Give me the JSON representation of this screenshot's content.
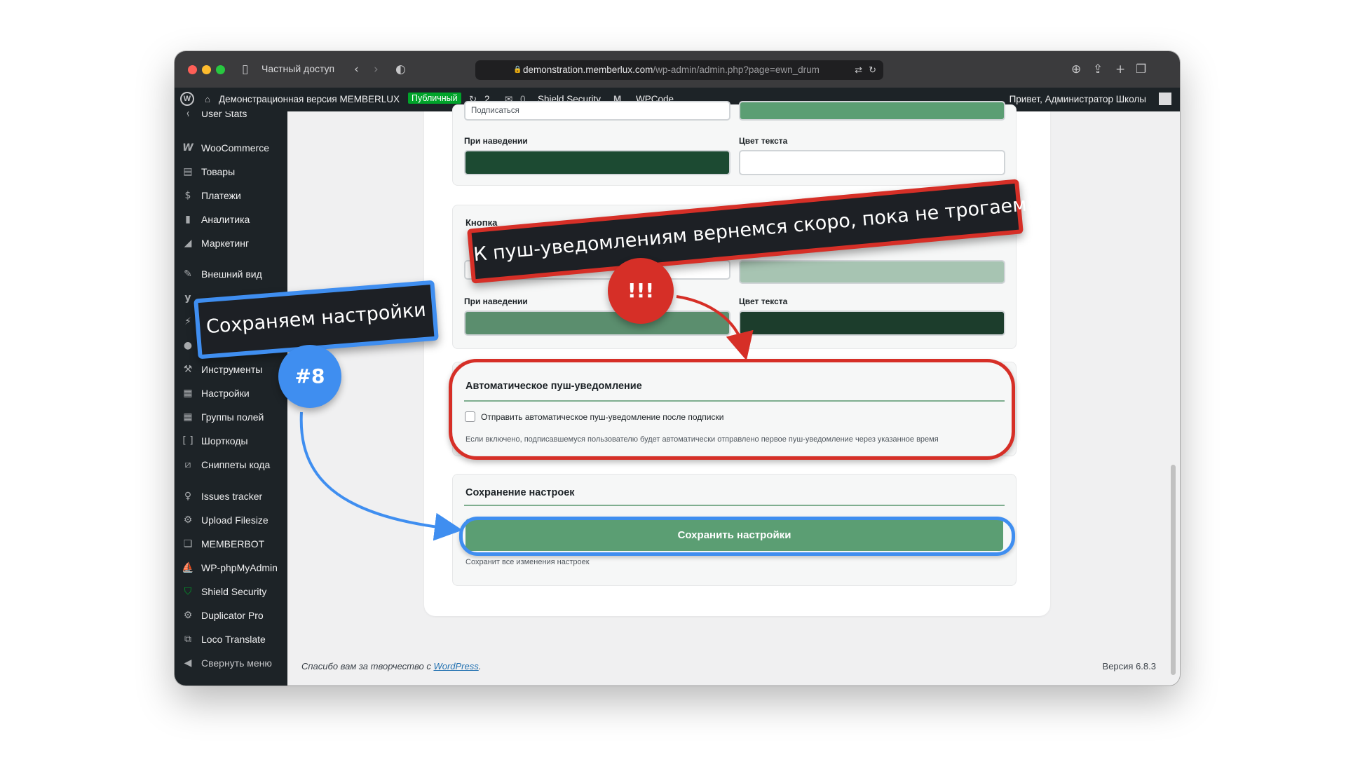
{
  "browser": {
    "tab_label": "Частный доступ",
    "url_domain": "demonstration.memberlux.com",
    "url_path": "/wp-admin/admin.php?page=ewn_drum"
  },
  "adminbar": {
    "site_name": "Демонстрационная версия MEMBERLUX",
    "badge": "Публичный",
    "updates_count": "2",
    "comments_count": "0",
    "shield_label": "Shield Security",
    "wpcode_label": "WPCode",
    "greeting": "Привет, Администратор Школы"
  },
  "sidebar": {
    "items": [
      {
        "label": "User Stats",
        "icon": "chart-icon"
      },
      {
        "label": "WooCommerce",
        "icon": "woo-icon"
      },
      {
        "label": "Товары",
        "icon": "archive-icon"
      },
      {
        "label": "Платежи",
        "icon": "dollar-icon"
      },
      {
        "label": "Аналитика",
        "icon": "bar-chart-icon"
      },
      {
        "label": "Маркетинг",
        "icon": "megaphone-icon"
      },
      {
        "label": "Внешний вид",
        "icon": "brush-icon"
      },
      {
        "label": "Инструменты",
        "icon": "wrench-icon"
      },
      {
        "label": "Настройки",
        "icon": "settings-icon"
      },
      {
        "label": "Группы полей",
        "icon": "grid-icon"
      },
      {
        "label": "Шорткоды",
        "icon": "brackets-icon"
      },
      {
        "label": "Сниппеты кода",
        "icon": "code-icon"
      },
      {
        "label": "Issues tracker",
        "icon": "lightbulb-icon"
      },
      {
        "label": "Upload Filesize",
        "icon": "gear-icon"
      },
      {
        "label": "MEMBERBOT",
        "icon": "chat-icon"
      },
      {
        "label": "WP-phpMyAdmin",
        "icon": "database-icon"
      },
      {
        "label": "Shield Security",
        "icon": "shield-icon"
      },
      {
        "label": "Duplicator Pro",
        "icon": "duplicate-icon"
      },
      {
        "label": "Loco Translate",
        "icon": "translate-icon"
      },
      {
        "label": "Свернуть меню",
        "icon": "collapse-icon"
      }
    ]
  },
  "form": {
    "subscribe_hover_label": "При наведении",
    "subscribe_textcolor_label": "Цвет текста",
    "button_section_title": "Кнопка",
    "button_hover_label": "При наведении",
    "button_textcolor_label": "Цвет текста",
    "top_input_partial": "Подписаться",
    "push_title": "Автоматическое пуш-уведомление",
    "push_checkbox_label": "Отправить автоматическое пуш-уведомление после подписки",
    "push_help": "Если включено, подписавшемуся пользователю будет автоматически отправлено первое пуш-уведомление через указанное время",
    "save_title": "Сохранение настроек",
    "save_button": "Сохранить настройки",
    "save_help": "Сохранит все изменения настроек"
  },
  "colors": {
    "top_right_swatch": "#5b9e73",
    "hover_swatch_1": "#1c4a32",
    "textcolor_swatch_1": "#ffffff",
    "normal_swatch_2": "#a7c4b2",
    "hover_swatch_2": "#5b8e6e",
    "textcolor_swatch_2": "#1c3d2c",
    "save_button": "#5b9e73"
  },
  "footer": {
    "thanks_prefix": "Спасибо вам за творчество с ",
    "thanks_link": "WordPress",
    "thanks_suffix": ".",
    "version": "Версия 6.8.3"
  },
  "annotations": {
    "red_callout": "К пуш-уведомлениям вернемся скоро, пока не трогаем!",
    "red_badge": "!!!",
    "blue_callout": "Сохраняем настройки",
    "blue_badge": "#8"
  }
}
